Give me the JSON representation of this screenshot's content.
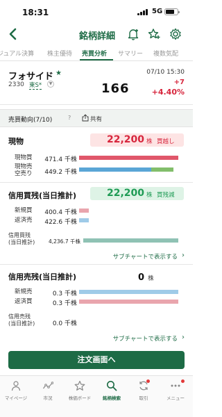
{
  "status_bar": {
    "time": "18:31",
    "network": "5G"
  },
  "header": {
    "title": "銘柄詳細"
  },
  "tabs": [
    {
      "label": "ジュアル決算"
    },
    {
      "label": "株主優待"
    },
    {
      "label": "売買分析"
    },
    {
      "label": "サマリー"
    },
    {
      "label": "複数気配"
    }
  ],
  "stock": {
    "name": "フォサイド",
    "code": "2330",
    "market": "東S*",
    "datetime": "07/10 15:30",
    "price": "166",
    "change": "+7",
    "change_pct": "+4.40%"
  },
  "trend": {
    "title": "売買動向(7/10)",
    "help": "?",
    "share_label": "共有"
  },
  "genbutsu": {
    "title": "現物",
    "summary_value": "22,200",
    "summary_unit": "株",
    "summary_kind": "買越し",
    "buy_label": "現物買",
    "buy_value": "471.4 千株",
    "sell_label_line1": "現物売",
    "sell_label_line2": "空売り",
    "sell_value": "449.2 千株"
  },
  "margin_buy": {
    "title": "信用買残(当日推計)",
    "summary_value": "22,200",
    "summary_unit": "株",
    "summary_kind": "買残減",
    "new_label": "新規買",
    "new_value": "400.4 千株",
    "repay_label": "返済売",
    "repay_value": "422.6 千株",
    "balance_label_line1": "信用買残",
    "balance_label_line2": "(当日推計)",
    "balance_value": "4,236.7 千株",
    "sub_link": "サブチャートで表示する"
  },
  "margin_sell": {
    "title": "信用売残(当日推計)",
    "summary_value": "0",
    "summary_unit": "株",
    "new_label": "新規売",
    "new_value": "0.3 千株",
    "repay_label": "返済買",
    "repay_value": "0.3 千株",
    "balance_label_line1": "信用売残",
    "balance_label_line2": "(当日推計)",
    "balance_value": "0.0 千株",
    "sub_link": "サブチャートで表示する"
  },
  "bars": {
    "genbutsu_buy": 1.0,
    "genbutsu_sell_short": 0.73,
    "genbutsu_sell_cash": 0.22,
    "margin_new_buy": 0.1,
    "margin_repay_sell": 0.1,
    "margin_balance": 1.0,
    "sell_new": 1.0,
    "sell_repay": 1.0
  },
  "order_button": "注文画面へ",
  "bottom_nav": [
    {
      "label": "マイページ"
    },
    {
      "label": "市況"
    },
    {
      "label": "株価ボード"
    },
    {
      "label": "銘柄検索"
    },
    {
      "label": "取引"
    },
    {
      "label": "メニュー"
    }
  ],
  "colors": {
    "brand": "#1d6b45",
    "up": "#d7263d",
    "buy_bar": "#e0576a",
    "sell_bar": "#5aa6d6",
    "sell_cash_bar": "#82be6b",
    "balance_bar": "#8fc2b4",
    "light_red": "#e9a5ad",
    "light_blue": "#9fcbe8"
  }
}
